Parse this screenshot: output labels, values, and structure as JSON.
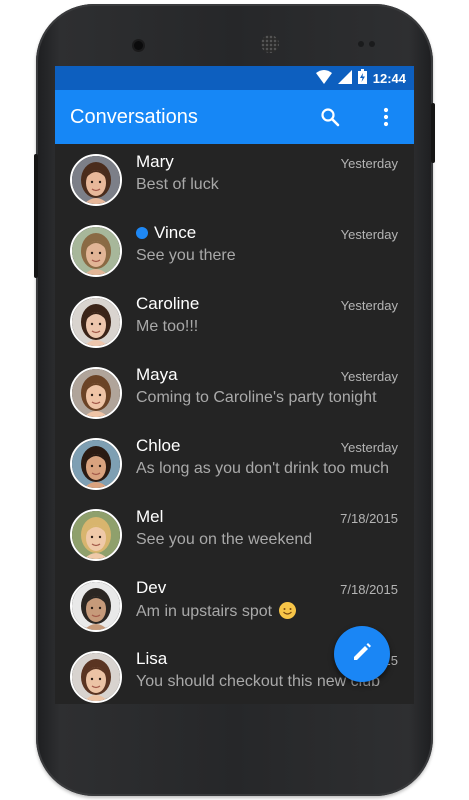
{
  "status_bar": {
    "time": "12:44"
  },
  "app_bar": {
    "title": "Conversations",
    "search_icon": "search-icon",
    "menu_icon": "more-vertical-icon"
  },
  "conversations": [
    {
      "name": "Mary",
      "date": "Yesterday",
      "message": "Best of luck",
      "unread": false,
      "avatar": {
        "skin": "#e8b89a",
        "hair": "#4a2c1c",
        "bg": "#7c7f88"
      }
    },
    {
      "name": "Vince",
      "date": "Yesterday",
      "message": "See you there",
      "unread": true,
      "avatar": {
        "skin": "#e2b596",
        "hair": "#8a6a44",
        "bg": "#a7b79a"
      }
    },
    {
      "name": "Caroline",
      "date": "Yesterday",
      "message": "Me too!!!",
      "unread": false,
      "avatar": {
        "skin": "#edc6ad",
        "hair": "#3b2418",
        "bg": "#d9d4cf"
      }
    },
    {
      "name": "Maya",
      "date": "Yesterday",
      "message": "Coming to Caroline's party tonight",
      "unread": false,
      "avatar": {
        "skin": "#efc4a6",
        "hair": "#6b4326",
        "bg": "#b0a49a"
      }
    },
    {
      "name": "Chloe",
      "date": "Yesterday",
      "message": "As long as you don't drink too much",
      "unread": false,
      "avatar": {
        "skin": "#d9a27e",
        "hair": "#2a1a12",
        "bg": "#7e9fb3"
      }
    },
    {
      "name": "Mel",
      "date": "7/18/2015",
      "message": "See you on the weekend",
      "unread": false,
      "avatar": {
        "skin": "#efc9a8",
        "hair": "#d8b56e",
        "bg": "#8fa06c"
      }
    },
    {
      "name": "Dev",
      "date": "7/18/2015",
      "message": "Am in upstairs spot",
      "unread": false,
      "emoji": "smiling-face-icon",
      "avatar": {
        "skin": "#c69a7a",
        "hair": "#2b2622",
        "bg": "#e9e9e9"
      }
    },
    {
      "name": "Lisa",
      "date": "7/18/2015",
      "message": "You should checkout this new club",
      "unread": false,
      "avatar": {
        "skin": "#ecc3a5",
        "hair": "#5a3422",
        "bg": "#d8d3cf"
      }
    }
  ],
  "fab": {
    "icon": "pencil-icon"
  }
}
